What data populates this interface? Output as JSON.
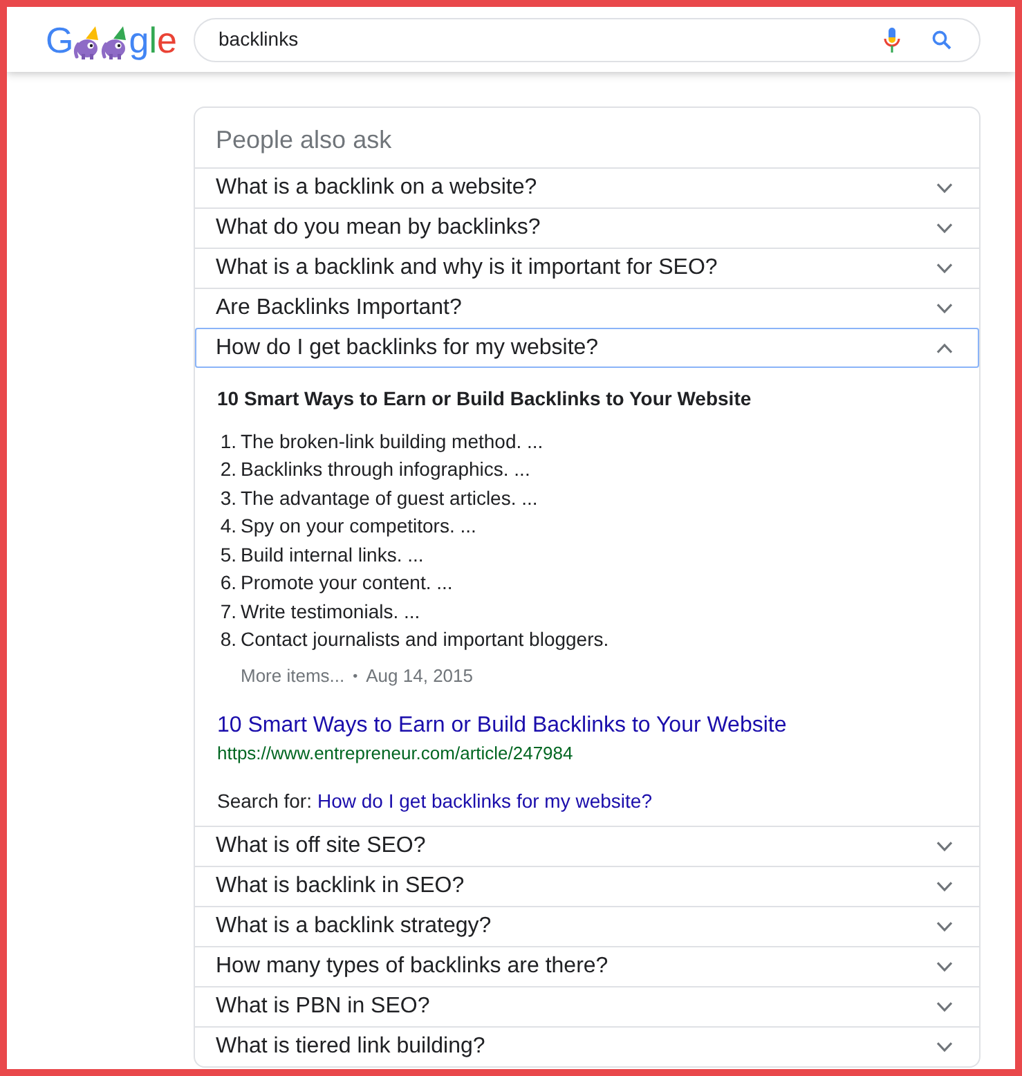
{
  "header": {
    "logo": {
      "letters_before": "G",
      "letters_after": "gle"
    },
    "search": {
      "value": "backlinks"
    }
  },
  "people_also_ask": {
    "title": "People also ask",
    "questions": [
      {
        "text": "What is a backlink on a website?",
        "expanded": false
      },
      {
        "text": "What do you mean by backlinks?",
        "expanded": false
      },
      {
        "text": "What is a backlink and why is it important for SEO?",
        "expanded": false
      },
      {
        "text": "Are Backlinks Important?",
        "expanded": false
      },
      {
        "text": "How do I get backlinks for my website?",
        "expanded": true,
        "answer": {
          "heading": "10 Smart Ways to Earn or Build Backlinks to Your Website",
          "list": [
            {
              "number": "1.",
              "text": "The broken-link building method. ..."
            },
            {
              "number": "2.",
              "text": "Backlinks through infographics. ..."
            },
            {
              "number": "3.",
              "text": "The advantage of guest articles. ..."
            },
            {
              "number": "4.",
              "text": "Spy on your competitors. ..."
            },
            {
              "number": "5.",
              "text": "Build internal links. ..."
            },
            {
              "number": "6.",
              "text": "Promote your content. ..."
            },
            {
              "number": "7.",
              "text": "Write testimonials. ..."
            },
            {
              "number": "8.",
              "text": "Contact journalists and important bloggers."
            }
          ],
          "more": "More items...",
          "separator": "•",
          "date": "Aug 14, 2015",
          "source_title": "10 Smart Ways to Earn or Build Backlinks to Your Website",
          "source_url": "https://www.entrepreneur.com/article/247984",
          "search_for_label": "Search for:",
          "search_for_link": "How do I get backlinks for my website?"
        }
      },
      {
        "text": "What is off site SEO?",
        "expanded": false
      },
      {
        "text": "What is backlink in SEO?",
        "expanded": false
      },
      {
        "text": "What is a backlink strategy?",
        "expanded": false
      },
      {
        "text": "How many types of backlinks are there?",
        "expanded": false
      },
      {
        "text": "What is PBN in SEO?",
        "expanded": false
      },
      {
        "text": "What is tiered link building?",
        "expanded": false
      }
    ]
  }
}
